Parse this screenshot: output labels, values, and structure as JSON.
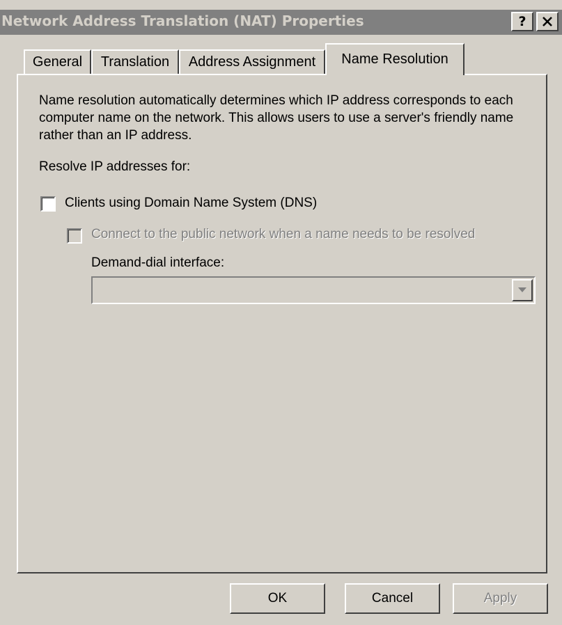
{
  "window": {
    "title": "Network Address Translation (NAT) Properties",
    "help_button": "?",
    "close_button": "✕"
  },
  "tabs": [
    {
      "label": "General",
      "active": false
    },
    {
      "label": "Translation",
      "active": false
    },
    {
      "label": "Address Assignment",
      "active": false
    },
    {
      "label": "Name Resolution",
      "active": true
    }
  ],
  "content": {
    "description": "Name resolution automatically determines which IP address corresponds to each computer name on the network. This allows users to use a server's friendly name rather than an IP address.",
    "resolve_label": "Resolve IP addresses for:",
    "dns_checkbox": {
      "label": "Clients using Domain Name System (DNS)",
      "checked": false,
      "enabled": true
    },
    "connect_checkbox": {
      "label": "Connect to the public network when a name needs to be resolved",
      "checked": false,
      "enabled": false
    },
    "demand_dial_label": "Demand-dial interface:",
    "demand_dial_value": ""
  },
  "buttons": {
    "ok": "OK",
    "cancel": "Cancel",
    "apply": "Apply"
  },
  "icons": {
    "combo_arrow": "chevron-down-icon"
  },
  "colors": {
    "face": "#d4d0c8",
    "inactive_title": "#808080",
    "disabled_text": "#808080"
  }
}
